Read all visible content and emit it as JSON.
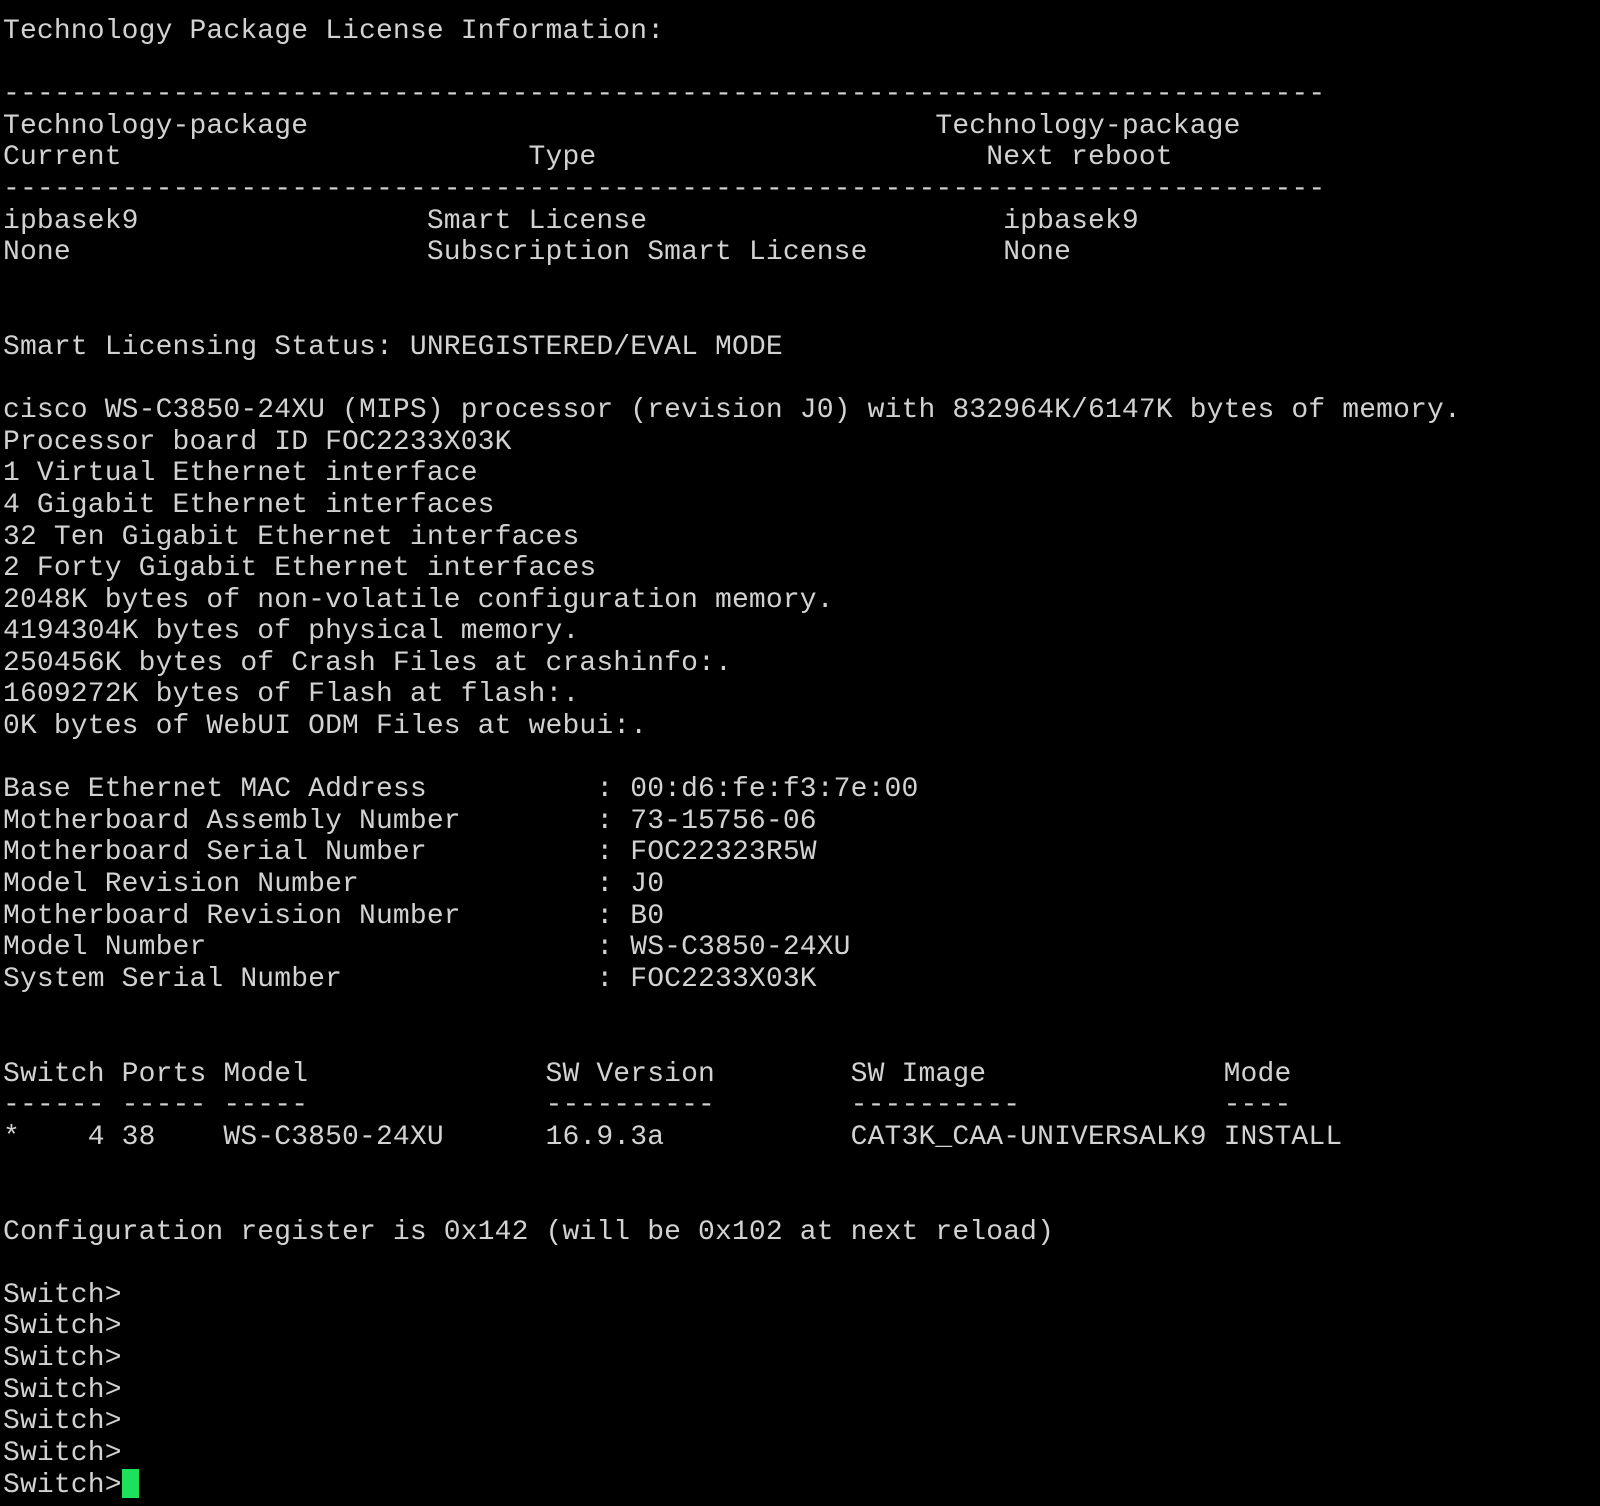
{
  "theme": {
    "background": "#000000",
    "text": "#d2d2d2",
    "cursor": "#1fe05a"
  },
  "terminal": {
    "lines": [
      "Technology Package License Information:",
      "",
      "------------------------------------------------------------------------------",
      "Technology-package                                     Technology-package",
      "Current                        Type                       Next reboot",
      "------------------------------------------------------------------------------",
      "ipbasek9                 Smart License                     ipbasek9",
      "None                     Subscription Smart License        None",
      "",
      "",
      "Smart Licensing Status: UNREGISTERED/EVAL MODE",
      "",
      "cisco WS-C3850-24XU (MIPS) processor (revision J0) with 832964K/6147K bytes of memory.",
      "Processor board ID FOC2233X03K",
      "1 Virtual Ethernet interface",
      "4 Gigabit Ethernet interfaces",
      "32 Ten Gigabit Ethernet interfaces",
      "2 Forty Gigabit Ethernet interfaces",
      "2048K bytes of non-volatile configuration memory.",
      "4194304K bytes of physical memory.",
      "250456K bytes of Crash Files at crashinfo:.",
      "1609272K bytes of Flash at flash:.",
      "0K bytes of WebUI ODM Files at webui:.",
      "",
      "Base Ethernet MAC Address          : 00:d6:fe:f3:7e:00",
      "Motherboard Assembly Number        : 73-15756-06",
      "Motherboard Serial Number          : FOC22323R5W",
      "Model Revision Number              : J0",
      "Motherboard Revision Number        : B0",
      "Model Number                       : WS-C3850-24XU",
      "System Serial Number               : FOC2233X03K",
      "",
      "",
      "Switch Ports Model              SW Version        SW Image              Mode",
      "------ ----- -----              ----------        ----------            ----",
      "*    4 38    WS-C3850-24XU      16.9.3a           CAT3K_CAA-UNIVERSALK9 INSTALL",
      "",
      "",
      "Configuration register is 0x142 (will be 0x102 at next reload)",
      "",
      "Switch>",
      "Switch>",
      "Switch>",
      "Switch>",
      "Switch>",
      "Switch>"
    ],
    "prompt": "Switch>"
  }
}
